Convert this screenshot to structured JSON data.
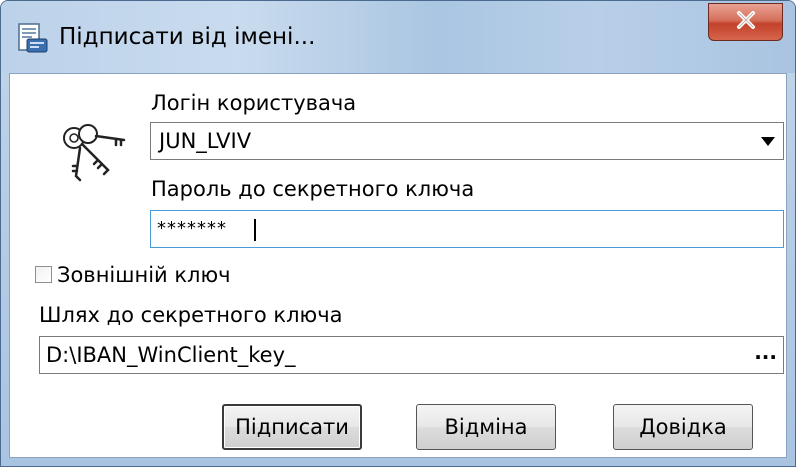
{
  "window": {
    "title": "Підписати від імені...",
    "title_icon": "sign-document-icon",
    "close_icon": "close-icon",
    "colors": {
      "close_button": "#c7432c",
      "input_focus_border": "#4a9bd9"
    }
  },
  "form": {
    "login_label": "Логін користувача",
    "login_value": "JUN_LVIV",
    "password_label": "Пароль до секретного ключа",
    "password_value": "*******",
    "external_key_label": "Зовнішній ключ",
    "external_key_checked": false,
    "key_path_label": "Шлях до секретного ключа",
    "key_path_value": "D:\\IBAN_WinClient_key_",
    "browse_label": "..."
  },
  "buttons": {
    "sign": "Підписати",
    "cancel": "Відміна",
    "help": "Довідка"
  }
}
